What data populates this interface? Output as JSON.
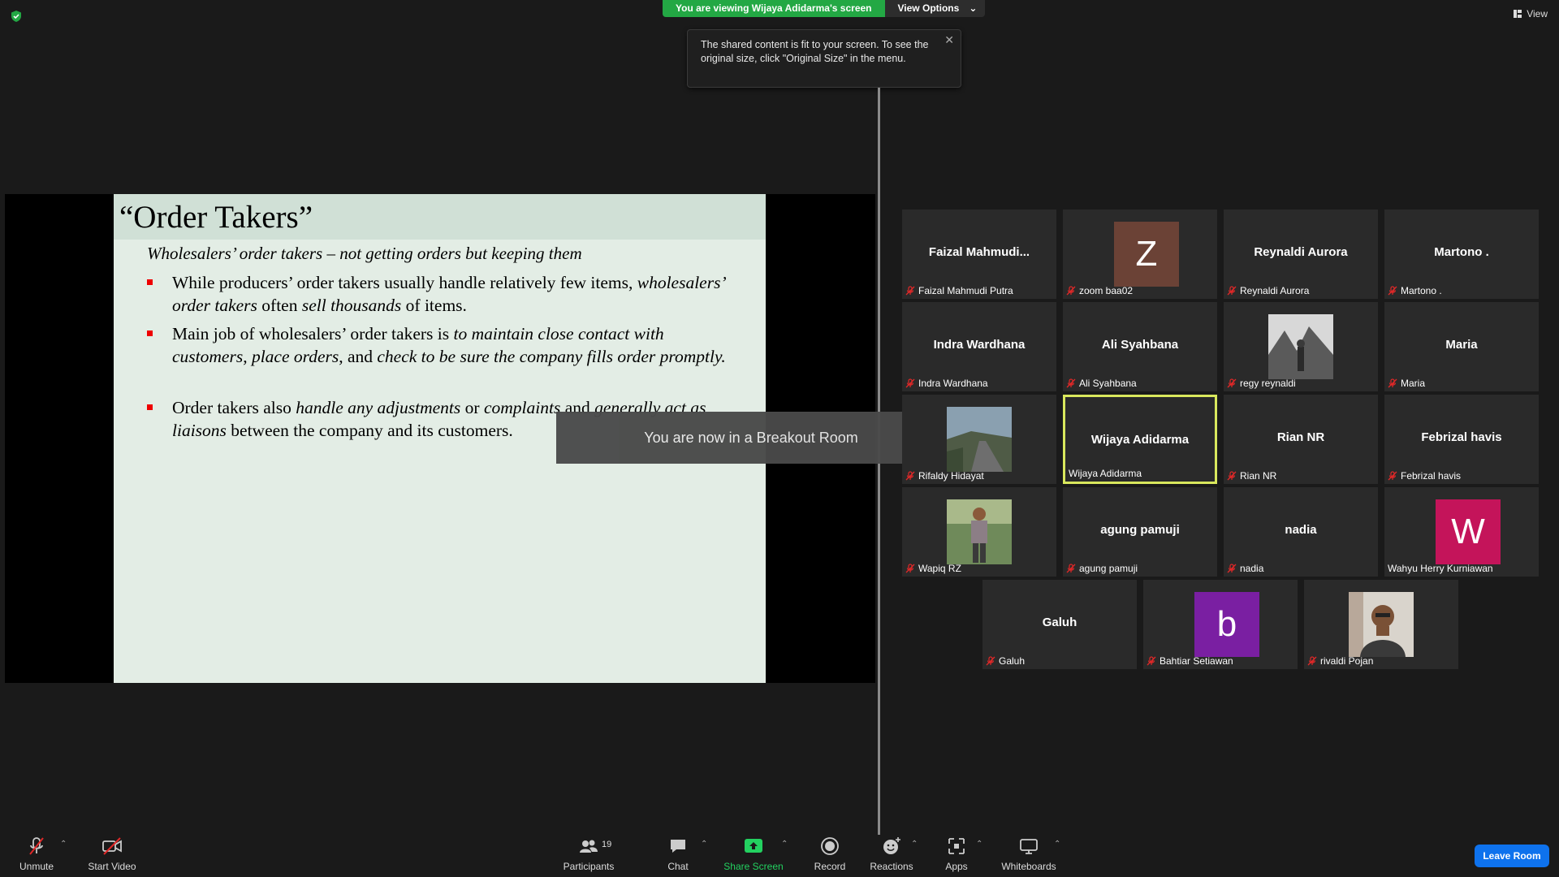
{
  "top": {
    "viewing_banner": "You are viewing Wijaya Adidarma's screen",
    "view_options": "View Options",
    "tooltip": "The shared content is fit to your screen. To see the original size, click \"Original Size\" in the menu.",
    "view_label": "View"
  },
  "slide": {
    "title": "“Order Takers”",
    "subtitle": "Wholesalers’ order takers – not getting orders but keeping them",
    "bullets": [
      {
        "html": "While producers’ order takers usually handle relatively few items, <i>wholesalers’ order takers</i> often <i>sell thousands</i> of items."
      },
      {
        "html": "Main job of wholesalers’ order takers is <i>to maintain close contact with customers</i>, <i>place orders</i>, and <i>check to be sure the company fills order promptly.</i>"
      },
      {
        "html": "Order takers also <i>handle any adjustments</i> or <i>complaints</i> and <i>generally act as liaisons</i> between the company and its customers."
      }
    ]
  },
  "breakout_notice": "You are now in a Breakout Room",
  "participants": [
    {
      "big": "Faizal  Mahmudi...",
      "label": "Faizal Mahmudi Putra",
      "muted": true
    },
    {
      "avatar": "Z",
      "avatar_color": "#6b4236",
      "label": "zoom baa02",
      "muted": true
    },
    {
      "big": "Reynaldi Aurora",
      "label": "Reynaldi Aurora",
      "muted": true
    },
    {
      "big": "Martono .",
      "label": "Martono .",
      "muted": true
    },
    {
      "big": "Indra Wardhana",
      "label": "Indra Wardhana",
      "muted": true
    },
    {
      "big": "Ali Syahbana",
      "label": "Ali Syahbana",
      "muted": true
    },
    {
      "photo": "snow",
      "label": "regy reynaldi",
      "muted": true
    },
    {
      "big": "Maria",
      "label": "Maria",
      "muted": true
    },
    {
      "photo": "road",
      "label": "Rifaldy Hidayat",
      "muted": true
    },
    {
      "big": "Wijaya Adidarma",
      "label": "Wijaya Adidarma",
      "muted": false,
      "active": true
    },
    {
      "big": "Rian NR",
      "label": "Rian NR",
      "muted": true
    },
    {
      "big": "Febrizal havis",
      "label": "Febrizal havis",
      "muted": true
    },
    {
      "photo": "man",
      "label": "Wapiq RZ",
      "muted": true
    },
    {
      "big": "agung pamuji",
      "label": "agung pamuji",
      "muted": true
    },
    {
      "big": "nadia",
      "label": "nadia",
      "muted": true
    },
    {
      "avatar": "W",
      "avatar_color": "#c4145a",
      "label": "Wahyu Herry Kurniawan",
      "muted": false
    },
    {
      "big": "Galuh",
      "label": "Galuh",
      "muted": true
    },
    {
      "avatar": "b",
      "avatar_color": "#7a1fa2",
      "label": "Bahtiar Setiawan",
      "muted": true
    },
    {
      "photo": "face",
      "label": "rivaldi Pojan",
      "muted": true
    }
  ],
  "toolbar": {
    "unmute": "Unmute",
    "start_video": "Start Video",
    "participants": "Participants",
    "participants_count": "19",
    "chat": "Chat",
    "share_screen": "Share Screen",
    "record": "Record",
    "reactions": "Reactions",
    "apps": "Apps",
    "whiteboards": "Whiteboards",
    "leave": "Leave Room"
  },
  "colors": {
    "share_green": "#23a844",
    "leave_blue": "#0e72ed",
    "active_border": "#d9e85d",
    "mic_red": "#e02828"
  }
}
